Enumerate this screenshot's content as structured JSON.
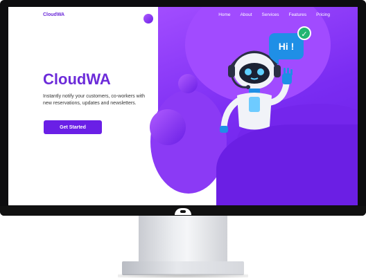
{
  "brand": {
    "name": "CloudWA"
  },
  "nav": {
    "items": [
      "Home",
      "About",
      "Services",
      "Features",
      "Pricing"
    ]
  },
  "hero": {
    "title": "CloudWA",
    "description": "Instantly notify your customers, co-workers with new reservations, updates and newsletters.",
    "cta_label": "Get Started"
  },
  "illustration": {
    "bubble_text": "Hi !",
    "icons": [
      "robot-icon",
      "check-icon"
    ]
  },
  "colors": {
    "accent": "#6c2bd9",
    "cta": "#6a1fe6",
    "bubble": "#1f8fe6",
    "check": "#22b573"
  }
}
